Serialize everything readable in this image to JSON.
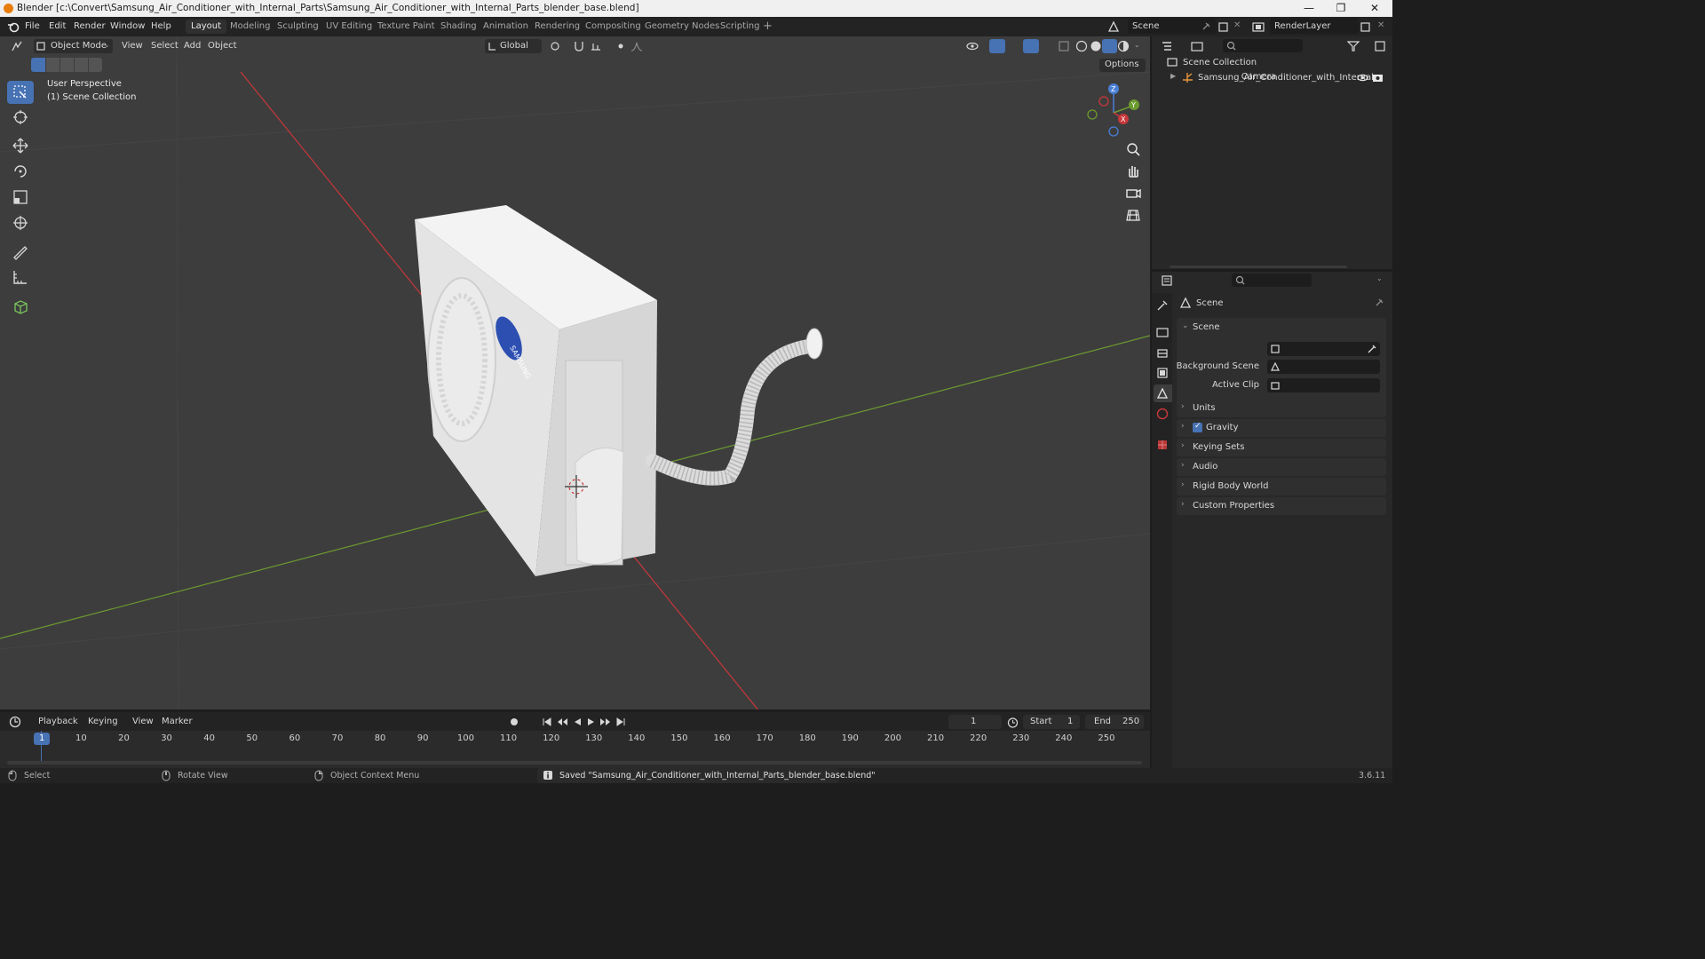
{
  "window": {
    "title": "Blender [c:\\Convert\\Samsung_Air_Conditioner_with_Internal_Parts\\Samsung_Air_Conditioner_with_Internal_Parts_blender_base.blend]",
    "minimize": "—",
    "maximize": "❐",
    "close": "✕"
  },
  "menubar": {
    "items": [
      "File",
      "Edit",
      "Render",
      "Window",
      "Help"
    ],
    "workspaces": [
      "Layout",
      "Modeling",
      "Sculpting",
      "UV Editing",
      "Texture Paint",
      "Shading",
      "Animation",
      "Rendering",
      "Compositing",
      "Geometry Nodes",
      "Scripting"
    ],
    "add_workspace": "+",
    "scene": "Scene",
    "render_layer": "RenderLayer"
  },
  "viewport_header": {
    "mode": "Object Mode",
    "menus": [
      "View",
      "Select",
      "Add",
      "Object"
    ],
    "orientation": "Global",
    "options": "Options"
  },
  "viewport": {
    "perspective": "User Perspective",
    "collection": "(1) Scene Collection",
    "gizmo_axes": [
      "Z",
      "Y",
      "X"
    ],
    "logo_text": "SAMSUNG"
  },
  "outliner": {
    "root": "Scene Collection",
    "items": [
      {
        "name": "Samsung_Air_Conditioner_with_Internal"
      }
    ]
  },
  "properties": {
    "context": "Scene",
    "panel_title": "Scene",
    "fields": {
      "camera": "Camera",
      "background_scene": "Background Scene",
      "active_clip": "Active Clip"
    },
    "sections": [
      {
        "label": "Units",
        "checkbox": false
      },
      {
        "label": "Gravity",
        "checkbox": true
      },
      {
        "label": "Keying Sets",
        "checkbox": false
      },
      {
        "label": "Audio",
        "checkbox": false
      },
      {
        "label": "Rigid Body World",
        "checkbox": false
      },
      {
        "label": "Custom Properties",
        "checkbox": false
      }
    ]
  },
  "timeline": {
    "menus": [
      "Playback",
      "Keying",
      "View",
      "Marker"
    ],
    "current_frame": "1",
    "start_label": "Start",
    "start": "1",
    "end_label": "End",
    "end": "250",
    "ticks": [
      "1",
      "10",
      "20",
      "30",
      "40",
      "50",
      "60",
      "70",
      "80",
      "90",
      "100",
      "110",
      "120",
      "130",
      "140",
      "150",
      "160",
      "170",
      "180",
      "190",
      "200",
      "210",
      "220",
      "230",
      "240",
      "250"
    ]
  },
  "statusbar": {
    "select": "Select",
    "rotate_view": "Rotate View",
    "context_menu": "Object Context Menu",
    "message": "Saved \"Samsung_Air_Conditioner_with_Internal_Parts_blender_base.blend\"",
    "version": "3.6.11"
  },
  "colors": {
    "accent": "#4772b3",
    "viewport_bg": "#3d3d3d",
    "x_axis": "#c8373a",
    "y_axis": "#6c9a2f",
    "z_axis": "#4a7fd6"
  }
}
